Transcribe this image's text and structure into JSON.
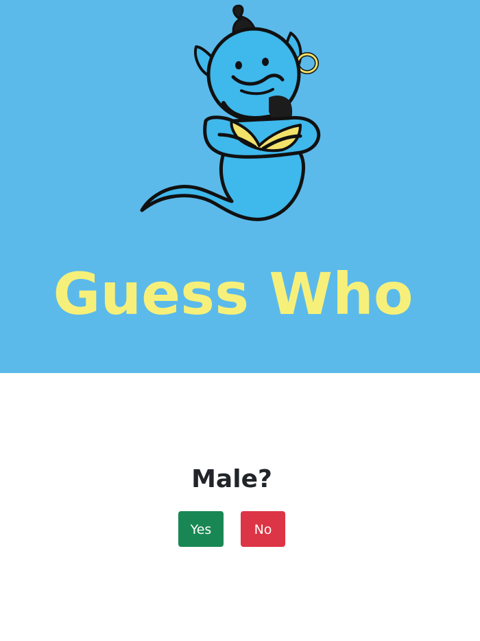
{
  "hero": {
    "title": "Guess Who",
    "background_color": "#5bbaea",
    "title_color": "#f6f07a",
    "logo_icon": "genie-icon"
  },
  "question": {
    "text": "Male?"
  },
  "buttons": {
    "yes_label": "Yes",
    "no_label": "No",
    "yes_color": "#198754",
    "no_color": "#dc3545"
  }
}
